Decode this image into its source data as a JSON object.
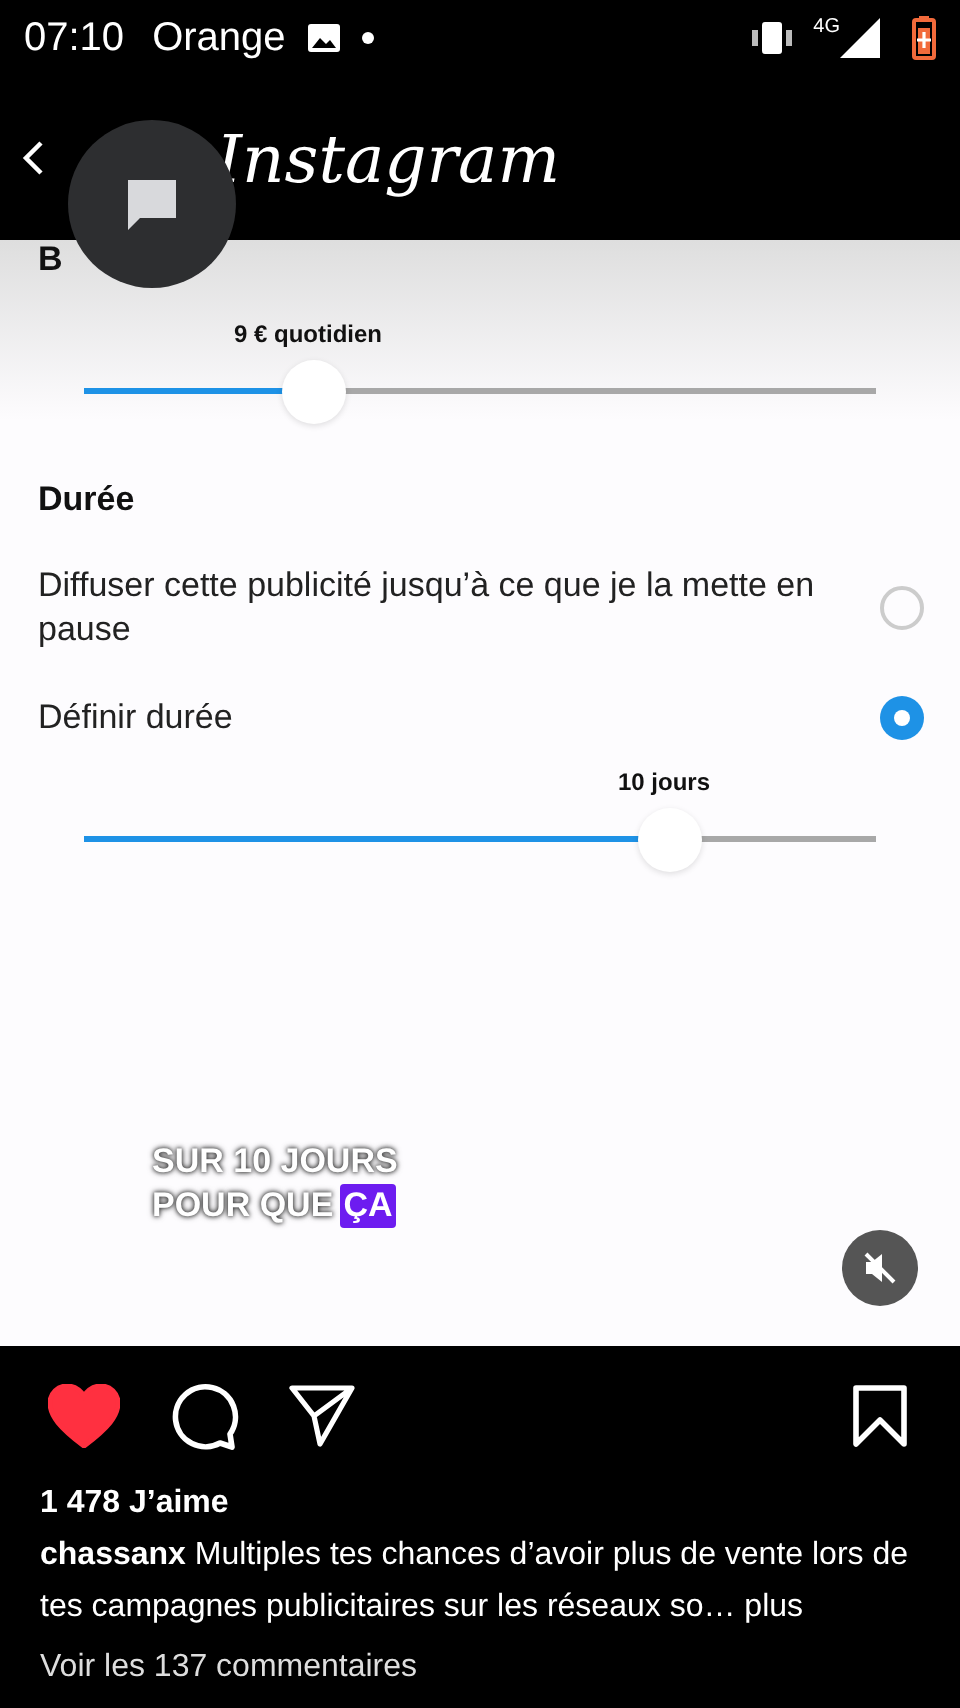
{
  "status_bar": {
    "time": "07:10",
    "carrier": "Orange",
    "network": "4G"
  },
  "header": {
    "logo": "Instagram"
  },
  "video": {
    "cut_heading": "B",
    "budget": {
      "reading": "9 € quotidien",
      "level": 0.29
    },
    "duration": {
      "title": "Durée",
      "options": [
        {
          "label": "Diffuser cette publicité jusqu’à ce que je la mette en pause",
          "selected": false
        },
        {
          "label": "Définir durée",
          "selected": true
        }
      ],
      "reading": "10 jours",
      "level": 0.74
    },
    "overlay_lines": [
      "SUR 10 JOURS",
      "POUR QUE"
    ],
    "overlay_highlight": "ÇA",
    "muted": true
  },
  "post": {
    "liked": true,
    "likes": "1 478 J’aime",
    "caption": "**chassanx** Multiples tes chances d’avoir plus de vente lors de tes campagnes publicitaires sur les réseaux so… plus",
    "comments": "Voir les 137 commentaires"
  }
}
